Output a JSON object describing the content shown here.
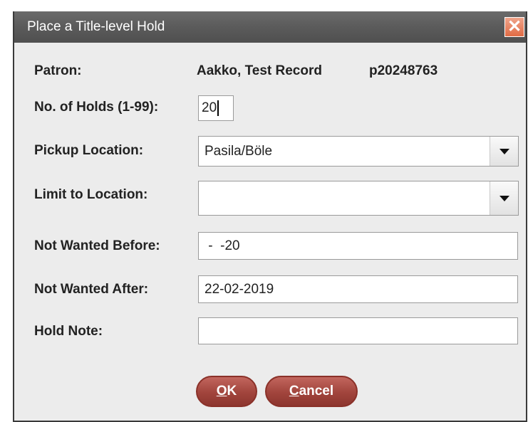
{
  "dialog": {
    "title": "Place a Title-level Hold",
    "close_glyph": "✕"
  },
  "patron": {
    "label": "Patron:",
    "name": "Aakko, Test Record",
    "id": "p20248763"
  },
  "holds": {
    "label": "No. of Holds (1-99):",
    "value": "20"
  },
  "pickup": {
    "label": "Pickup Location:",
    "value": "Pasila/Böle"
  },
  "limit": {
    "label": "Limit to Location:",
    "value": ""
  },
  "not_before": {
    "label": "Not Wanted Before:",
    "value": " -  -20"
  },
  "not_after": {
    "label": "Not Wanted After:",
    "value": "22-02-2019"
  },
  "note": {
    "label": "Hold Note:",
    "value": ""
  },
  "buttons": {
    "ok_mnemonic": "O",
    "ok_rest": "K",
    "cancel_mnemonic": "C",
    "cancel_rest": "ancel"
  },
  "colors": {
    "titlebar": "#5b5b5b",
    "button": "#a1443c",
    "close": "#e06b45"
  }
}
